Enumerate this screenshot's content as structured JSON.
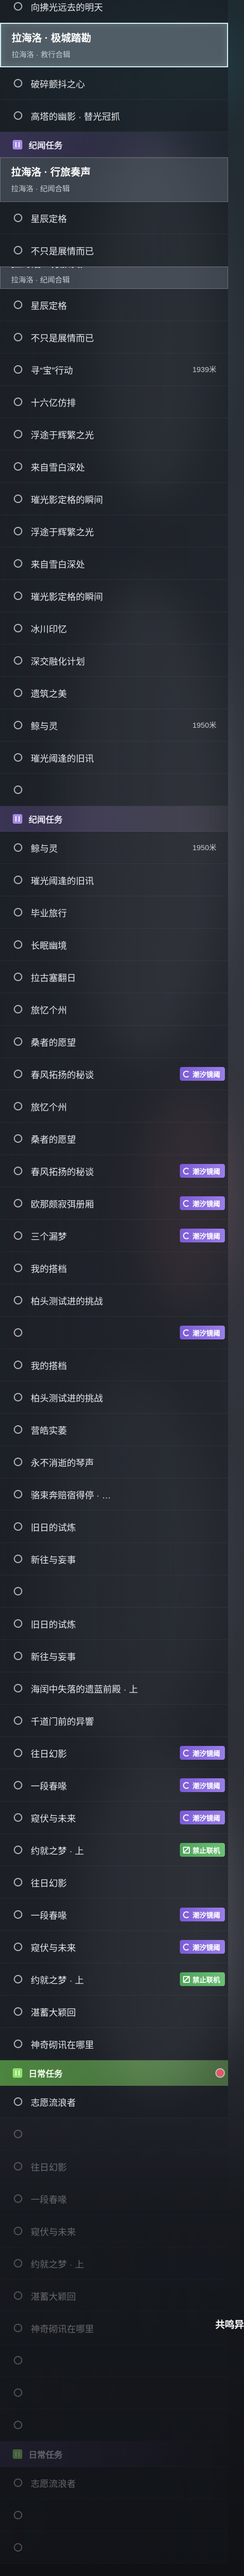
{
  "colors": {
    "tide_badge": "#7b5bd6",
    "coop_badge": "#4fa35a",
    "selected_border": "#cfeef2",
    "background": "#262c34"
  },
  "corner_text": "共鸣异",
  "rows": [
    {
      "text": "向拂光远去的明天",
      "clipped": true
    },
    {
      "title": "拉海洛 · 极城踏勘",
      "subtitle": "拉海洛 · 救行合辑",
      "selected": true
    },
    {
      "text": "破碎颤抖之心"
    },
    {
      "text": "高塔的幽影 · 替光冠抓"
    },
    {
      "category": "纪闻任务",
      "accent": "#a58be6"
    },
    {
      "title": "拉海洛 · 行旅奏声",
      "subtitle": "拉海洛 · 纪闻合辑"
    },
    {
      "text": "星辰定格"
    },
    {
      "text": "不只是展情而已"
    },
    {
      "title": "拉海洛 · 行旅奏声",
      "subtitle": "拉海洛 · 纪闻合辑",
      "clipped": true
    },
    {
      "text": "星辰定格"
    },
    {
      "text": "不只是展情而已"
    },
    {
      "text": "寻“宝”行动",
      "distance": "1939米"
    },
    {
      "text": "十六亿仿排"
    },
    {
      "text": "浮途于辉繁之光"
    },
    {
      "text": "来自雪白深处"
    },
    {
      "text": "璀光影定格的瞬间"
    },
    {
      "text": "浮途于辉繁之光"
    },
    {
      "text": "来自雪白深处"
    },
    {
      "text": "璀光影定格的瞬间"
    },
    {
      "text": "冰川印忆"
    },
    {
      "text": "深交融化计划"
    },
    {
      "text": "遗筑之美"
    },
    {
      "text": "鲸与灵",
      "distance": "1950米"
    },
    {
      "text": "璀光阈逢的旧讯"
    },
    {
      "text": ""
    },
    {
      "category": "纪闻任务",
      "accent": "#a58be6"
    },
    {
      "text": "鲸与灵",
      "distance": "1950米"
    },
    {
      "text": "璀光阈逢的旧讯"
    },
    {
      "text": "毕业旅行"
    },
    {
      "text": "长眠幽境"
    },
    {
      "text": "拉古塞翻日"
    },
    {
      "text": "旅忆个州"
    },
    {
      "text": "桑者的愿望"
    },
    {
      "text": "春风拓扬的秘谈",
      "tide_badge": "潮汐镜阈"
    },
    {
      "text": "旅忆个州"
    },
    {
      "text": "桑者的愿望"
    },
    {
      "text": "春风拓扬的秘谈",
      "tide_badge": "潮汐镜阈"
    },
    {
      "text": "欧那颇寂弭册厢",
      "tide_badge": "潮汐镜阈"
    },
    {
      "text": "三个漏梦",
      "tide_badge": "潮汐镜阈"
    },
    {
      "text": "我的搭档"
    },
    {
      "text": "柏头测试进的挑战"
    },
    {
      "text": "",
      "tide_badge": "潮汐镜阈"
    },
    {
      "text": "我的搭档"
    },
    {
      "text": "柏头测试进的挑战"
    },
    {
      "text": "营皓实萎"
    },
    {
      "text": "永不消逝的琴声"
    },
    {
      "text": "骆束奔赔宿得停 · …"
    },
    {
      "text": "旧日的试炼"
    },
    {
      "text": "新往与妄事"
    },
    {
      "text": ""
    },
    {
      "text": "旧日的试炼"
    },
    {
      "text": "新往与妄事"
    },
    {
      "text": "海闰中失落的遗蓝前殿 · 上"
    },
    {
      "text": "千道门前的异響"
    },
    {
      "text": "往日幻影",
      "tide_badge": "潮汐镜阈"
    },
    {
      "text": "一段春喙",
      "tide_badge": "潮汐镜阈"
    },
    {
      "text": "窥伏与未来",
      "tide_badge": "潮汐镜阈"
    },
    {
      "text": "约就之梦 · 上",
      "coop_badge": "禁止联机"
    },
    {
      "text": "往日幻影"
    },
    {
      "text": "一段春喙",
      "tide_badge": "潮汐镜阈"
    },
    {
      "text": "窥伏与未来",
      "tide_badge": "潮汐镜阈"
    },
    {
      "text": "约就之梦 · 上",
      "coop_badge": "禁止联机"
    },
    {
      "text": "湛蓄大颖回"
    },
    {
      "text": "神奇砌讯在哪里"
    },
    {
      "category": "日常任务",
      "accent": "#8fe06a",
      "highlight": true
    },
    {
      "text": "志愿流浪者"
    },
    {
      "text": "",
      "dim": true
    },
    {
      "text": "往日幻影",
      "dim": true
    },
    {
      "text": "一段春喙",
      "dim": true
    },
    {
      "text": "窥伏与未来",
      "dim": true
    },
    {
      "text": "约就之梦 · 上",
      "dim": true
    },
    {
      "text": "湛蓄大颖回",
      "dim": true
    },
    {
      "text": "神奇砌讯在哪里",
      "dim": true
    },
    {
      "text": "",
      "dim": true
    },
    {
      "text": "",
      "dim": true
    },
    {
      "text": "",
      "dim": true
    },
    {
      "category": "日常任务",
      "accent": "#8fe06a",
      "dim": true
    },
    {
      "text": "志愿流浪者",
      "dim": true
    },
    {
      "text": "",
      "dim": true
    },
    {
      "text": "",
      "dim": true
    }
  ]
}
